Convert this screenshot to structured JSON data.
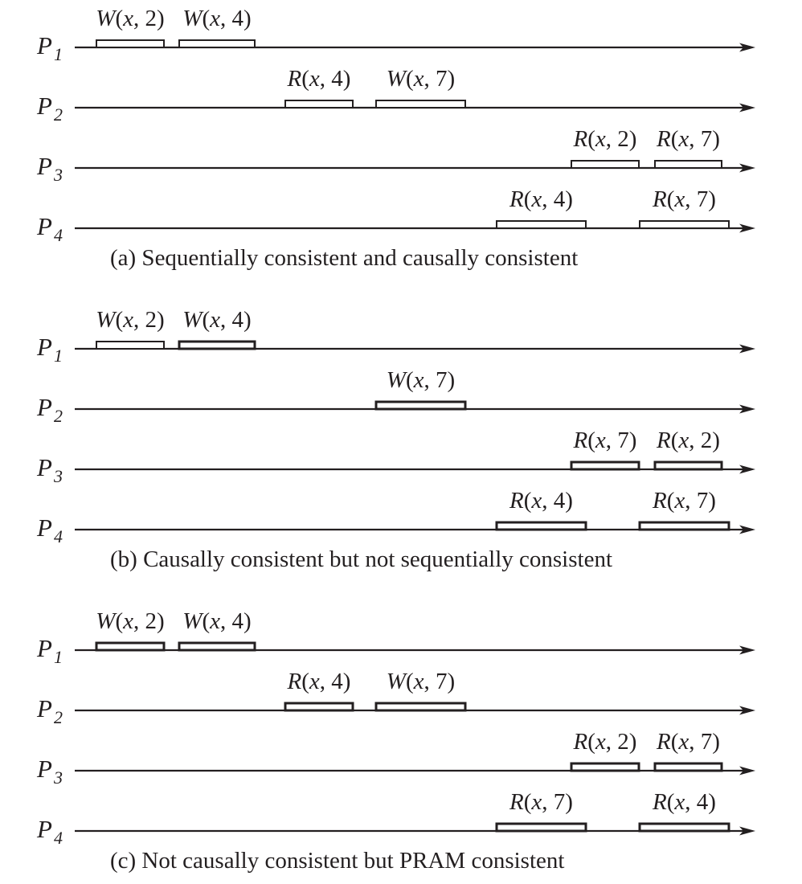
{
  "panels": [
    {
      "caption": "(a) Sequentially consistent and causally consistent",
      "processes": [
        {
          "letter": "P",
          "index": "1",
          "ops": [
            {
              "kind": "W",
              "value": "2",
              "start": 120,
              "end": 204
            },
            {
              "kind": "W",
              "value": "4",
              "start": 223,
              "end": 317
            }
          ]
        },
        {
          "letter": "P",
          "index": "2",
          "ops": [
            {
              "kind": "R",
              "value": "4",
              "start": 355,
              "end": 439
            },
            {
              "kind": "W",
              "value": "7",
              "start": 468,
              "end": 579
            }
          ]
        },
        {
          "letter": "P",
          "index": "3",
          "ops": [
            {
              "kind": "R",
              "value": "2",
              "start": 711,
              "end": 795
            },
            {
              "kind": "R",
              "value": "7",
              "start": 815,
              "end": 898
            }
          ]
        },
        {
          "letter": "P",
          "index": "4",
          "ops": [
            {
              "kind": "R",
              "value": "4",
              "start": 618,
              "end": 729
            },
            {
              "kind": "R",
              "value": "7",
              "start": 796,
              "end": 907
            }
          ]
        }
      ]
    },
    {
      "caption": "(b) Causally consistent but not sequentially consistent",
      "processes": [
        {
          "letter": "P",
          "index": "1",
          "ops": [
            {
              "kind": "W",
              "value": "2",
              "start": 120,
              "end": 204
            },
            {
              "kind": "W",
              "value": "4",
              "start": 223,
              "end": 317
            }
          ]
        },
        {
          "letter": "P",
          "index": "2",
          "ops": [
            {
              "kind": "W",
              "value": "7",
              "start": 468,
              "end": 579
            }
          ]
        },
        {
          "letter": "P",
          "index": "3",
          "ops": [
            {
              "kind": "R",
              "value": "7",
              "start": 711,
              "end": 795
            },
            {
              "kind": "R",
              "value": "2",
              "start": 815,
              "end": 898
            }
          ]
        },
        {
          "letter": "P",
          "index": "4",
          "ops": [
            {
              "kind": "R",
              "value": "4",
              "start": 618,
              "end": 729
            },
            {
              "kind": "R",
              "value": "7",
              "start": 796,
              "end": 907
            }
          ]
        }
      ]
    },
    {
      "caption": "(c) Not causally consistent but PRAM consistent",
      "processes": [
        {
          "letter": "P",
          "index": "1",
          "ops": [
            {
              "kind": "W",
              "value": "2",
              "start": 120,
              "end": 204
            },
            {
              "kind": "W",
              "value": "4",
              "start": 223,
              "end": 317
            }
          ]
        },
        {
          "letter": "P",
          "index": "2",
          "ops": [
            {
              "kind": "R",
              "value": "4",
              "start": 355,
              "end": 439
            },
            {
              "kind": "W",
              "value": "7",
              "start": 468,
              "end": 579
            }
          ]
        },
        {
          "letter": "P",
          "index": "3",
          "ops": [
            {
              "kind": "R",
              "value": "2",
              "start": 711,
              "end": 795
            },
            {
              "kind": "R",
              "value": "7",
              "start": 815,
              "end": 898
            }
          ]
        },
        {
          "letter": "P",
          "index": "4",
          "ops": [
            {
              "kind": "R",
              "value": "7",
              "start": 618,
              "end": 729
            },
            {
              "kind": "R",
              "value": "4",
              "start": 796,
              "end": 907
            }
          ]
        }
      ]
    }
  ],
  "variable": "x",
  "colors": {
    "ink": "#231f20",
    "background": "#ffffff"
  }
}
